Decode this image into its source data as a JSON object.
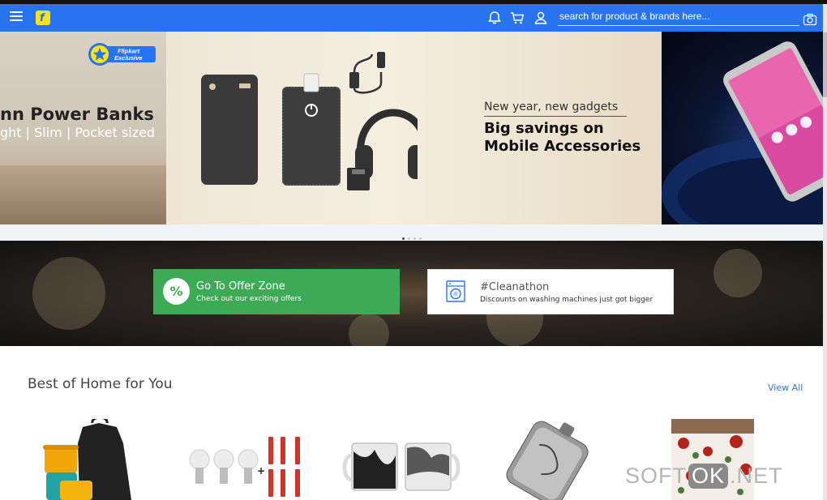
{
  "header": {
    "search_placeholder": "search for product & brands here...",
    "icons": [
      "menu-icon",
      "flipkart-logo",
      "bell-icon",
      "cart-icon",
      "user-icon",
      "camera-icon"
    ],
    "color": "#2874f0"
  },
  "banner": {
    "left_slide": {
      "badge_line1": "Flipkart",
      "badge_line2": "Exclusive",
      "title": "nn Power Banks",
      "subtitle": "ght | Slim | Pocket sized"
    },
    "main_slide": {
      "kicker": "New year, new gadgets",
      "headline_line1": "Big savings on",
      "headline_line2": "Mobile Accessories"
    },
    "carousel_dots": 4,
    "active_dot": 0
  },
  "offers": [
    {
      "title": "Go To Offer Zone",
      "subtitle": "Check out our exciting offers",
      "icon": "percent-icon",
      "color": "#3dab55"
    },
    {
      "title": "#Cleanathon",
      "subtitle": "Discounts on washing machines just got bigger",
      "icon": "washing-machine-icon"
    }
  ],
  "section": {
    "title": "Best of Home for You",
    "view_all": "View All",
    "products": [
      "tupperware-set",
      "led-bulbs-and-batteries",
      "printed-mugs",
      "hip-flask",
      "bedsheet"
    ]
  },
  "watermark": {
    "left": "SOFT",
    "mid": "OK",
    "right": ".NET"
  }
}
